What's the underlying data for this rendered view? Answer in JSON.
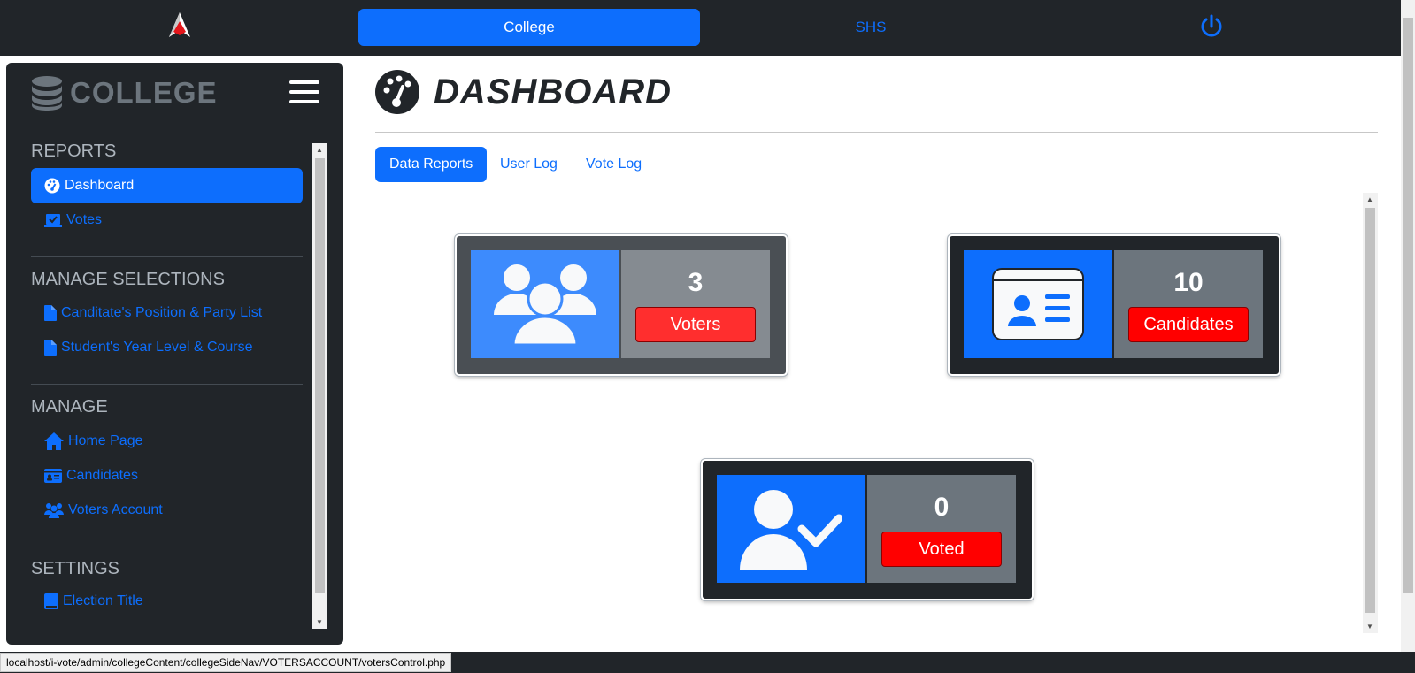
{
  "topbar": {
    "tabs": [
      {
        "label": "College",
        "active": true
      },
      {
        "label": "SHS",
        "active": false
      }
    ]
  },
  "sidebar": {
    "title": "COLLEGE",
    "sections": [
      {
        "heading": "REPORTS",
        "items": [
          {
            "label": "Dashboard",
            "icon": "gauge-icon",
            "active": true
          },
          {
            "label": "Votes",
            "icon": "vote-box-icon"
          }
        ]
      },
      {
        "heading": "MANAGE SELECTIONS",
        "items": [
          {
            "label": "Canditate's Position & Party List",
            "icon": "file-icon"
          },
          {
            "label": "Student's Year Level & Course",
            "icon": "file-icon"
          }
        ]
      },
      {
        "heading": "MANAGE",
        "items": [
          {
            "label": "Home Page",
            "icon": "home-icon"
          },
          {
            "label": "Candidates",
            "icon": "id-card-icon"
          },
          {
            "label": "Voters Account",
            "icon": "users-icon"
          }
        ]
      },
      {
        "heading": "SETTINGS",
        "items": [
          {
            "label": "Election Title",
            "icon": "book-icon"
          }
        ]
      }
    ]
  },
  "main": {
    "title": "DASHBOARD",
    "tabs": [
      {
        "label": "Data Reports",
        "active": true
      },
      {
        "label": "User Log"
      },
      {
        "label": "Vote Log"
      }
    ],
    "cards": [
      {
        "count": "3",
        "label": "Voters",
        "icon": "users-icon"
      },
      {
        "count": "10",
        "label": "Candidates",
        "icon": "id-card-icon"
      },
      {
        "count": "0",
        "label": "Voted",
        "icon": "user-check-icon"
      }
    ]
  },
  "statusbar": {
    "url": "localhost/i-vote/admin/collegeContent/collegeSideNav/VOTERSACCOUNT/votersControl.php"
  },
  "colors": {
    "primary": "#0d6efd",
    "dark": "#212529",
    "danger": "#ff0000",
    "secondary": "#6c757d"
  }
}
